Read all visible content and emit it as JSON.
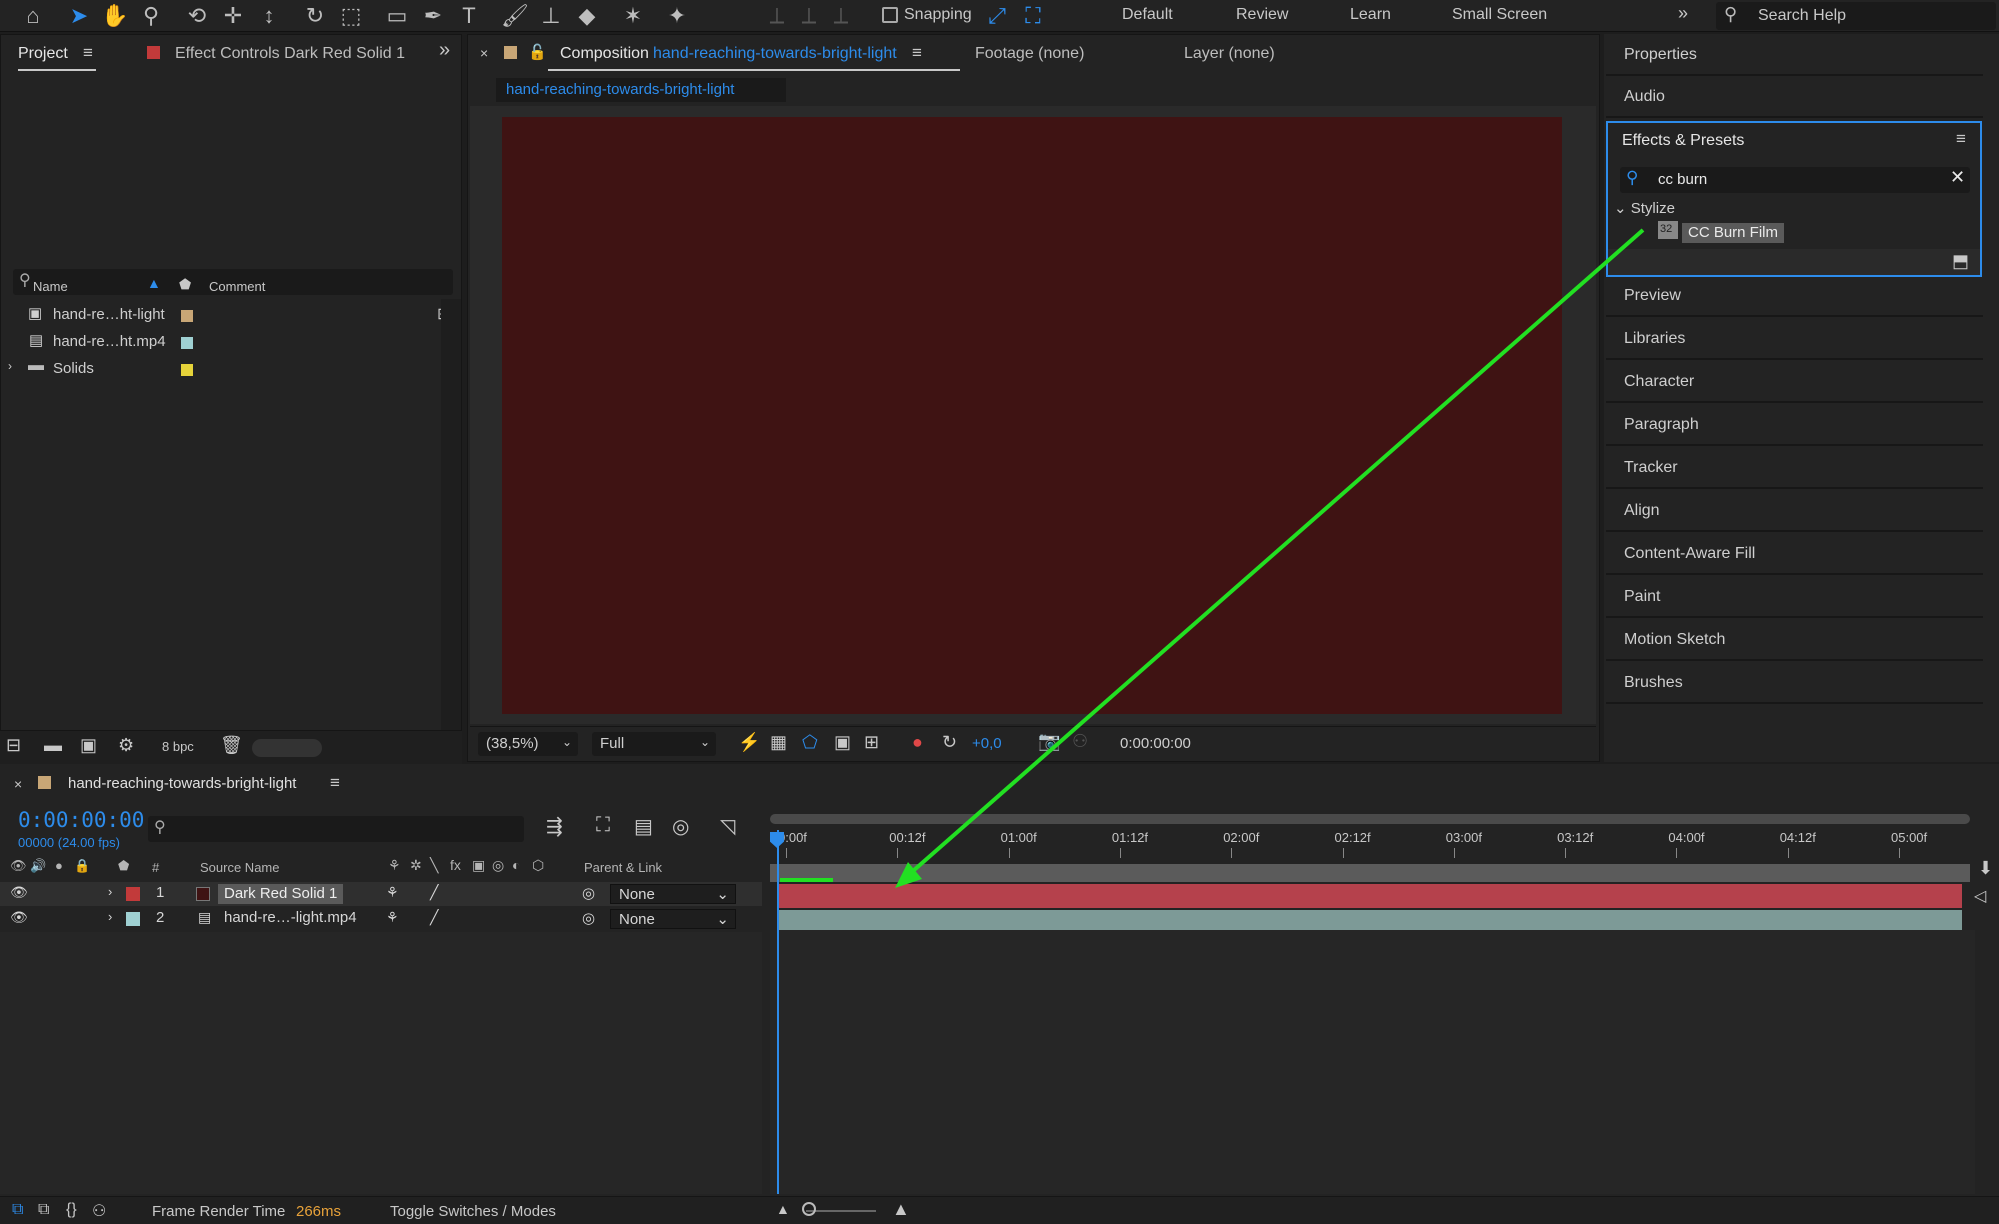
{
  "toolbar": {
    "snapping_label": "Snapping",
    "workspaces": [
      "Default",
      "Review",
      "Learn",
      "Small Screen"
    ],
    "search_placeholder": "Search Help",
    "accent_color": "#2d8ceb"
  },
  "project_panel": {
    "tab_project": "Project",
    "tab_effect_controls": "Effect Controls Dark Red Solid 1",
    "columns": {
      "name": "Name",
      "comment": "Comment"
    },
    "items": [
      {
        "name": "hand-re…ht-light",
        "color": "#c8a676"
      },
      {
        "name": "hand-re…ht.mp4",
        "color": "#9fd0d2"
      },
      {
        "name": "Solids",
        "color": "#e6d33a"
      }
    ],
    "bpc": "8 bpc"
  },
  "comp_viewer": {
    "tab_prefix": "Composition",
    "comp_name": "hand-reaching-towards-bright-light",
    "footage_tab": "Footage (none)",
    "layer_tab": "Layer (none)",
    "subtab": "hand-reaching-towards-bright-light",
    "canvas_color": "#3f1313",
    "zoom": "(38,5%)",
    "resolution": "Full",
    "exposure": "+0,0",
    "timecode": "0:00:00:00"
  },
  "right_panels": {
    "items_top": [
      "Properties",
      "Audio"
    ],
    "effects": {
      "title": "Effects & Presets",
      "search_value": "cc burn",
      "category": "Stylize",
      "result": "CC Burn Film"
    },
    "items_bottom": [
      "Preview",
      "Libraries",
      "Character",
      "Paragraph",
      "Tracker",
      "Align",
      "Content-Aware Fill",
      "Paint",
      "Motion Sketch",
      "Brushes"
    ]
  },
  "timeline": {
    "comp_name": "hand-reaching-towards-bright-light",
    "current_time": "0:00:00:00",
    "fps_label": "00000 (24.00 fps)",
    "columns": {
      "num": "#",
      "source_name": "Source Name",
      "parent": "Parent & Link"
    },
    "ruler_labels": [
      "0:00f",
      "00:12f",
      "01:00f",
      "01:12f",
      "02:00f",
      "02:12f",
      "03:00f",
      "03:12f",
      "04:00f",
      "04:12f",
      "05:00f"
    ],
    "layers": [
      {
        "num": "1",
        "name": "Dark Red Solid 1",
        "label_color": "#c23a3a",
        "parent": "None",
        "bar_color": "#b5414c"
      },
      {
        "num": "2",
        "name": "hand-re…-light.mp4",
        "label_color": "#9fd0d2",
        "parent": "None",
        "bar_color": "#7d9a97"
      }
    ]
  },
  "status": {
    "frame_render_label": "Frame Render Time",
    "frame_render_value": "266ms",
    "toggle_label": "Toggle Switches / Modes"
  },
  "annotation": {
    "arrow_color": "#22e022"
  }
}
